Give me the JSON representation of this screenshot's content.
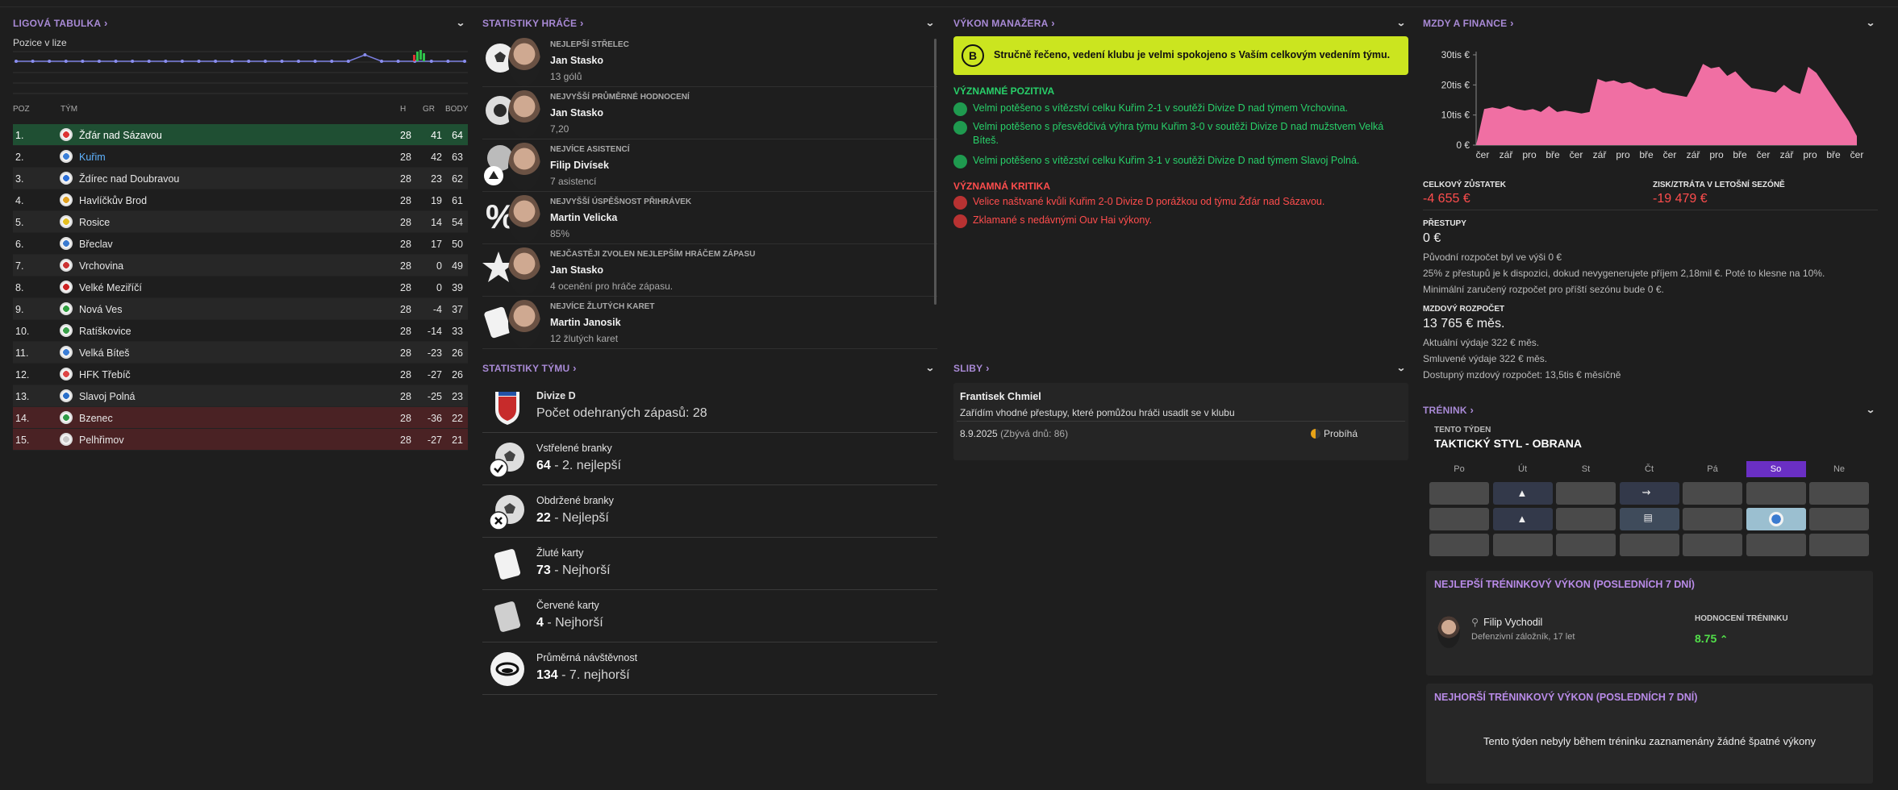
{
  "league": {
    "title": "LIGOVÁ TABULKA",
    "pos_label": "Pozice v lize",
    "cols": {
      "poz": "POZ",
      "tym": "TÝM",
      "h": "H",
      "gr": "GR",
      "body": "BODY"
    },
    "rows": [
      {
        "poz": "1.",
        "team": "Žďár nad Sázavou",
        "h": "28",
        "gr": "41",
        "body": "64",
        "style": "top",
        "crest": "#d33"
      },
      {
        "poz": "2.",
        "team": "Kuřim",
        "h": "28",
        "gr": "42",
        "body": "63",
        "style": "user",
        "crest": "#3a7fd8"
      },
      {
        "poz": "3.",
        "team": "Ždírec nad Doubravou",
        "h": "28",
        "gr": "23",
        "body": "62",
        "style": "",
        "crest": "#2b6fd8"
      },
      {
        "poz": "4.",
        "team": "Havlíčkův Brod",
        "h": "28",
        "gr": "19",
        "body": "61",
        "style": "",
        "crest": "#e0a020"
      },
      {
        "poz": "5.",
        "team": "Rosice",
        "h": "28",
        "gr": "14",
        "body": "54",
        "style": "",
        "crest": "#e6c021"
      },
      {
        "poz": "6.",
        "team": "Břeclav",
        "h": "28",
        "gr": "17",
        "body": "50",
        "style": "",
        "crest": "#3b7bd0"
      },
      {
        "poz": "7.",
        "team": "Vrchovina",
        "h": "28",
        "gr": "0",
        "body": "49",
        "style": "",
        "crest": "#c33"
      },
      {
        "poz": "8.",
        "team": "Velké Meziříčí",
        "h": "28",
        "gr": "0",
        "body": "39",
        "style": "",
        "crest": "#c22"
      },
      {
        "poz": "9.",
        "team": "Nová Ves",
        "h": "28",
        "gr": "-4",
        "body": "37",
        "style": "",
        "crest": "#2f9e3f"
      },
      {
        "poz": "10.",
        "team": "Ratíškovice",
        "h": "28",
        "gr": "-14",
        "body": "33",
        "style": "",
        "crest": "#3aa04a"
      },
      {
        "poz": "11.",
        "team": "Velká Bíteš",
        "h": "28",
        "gr": "-23",
        "body": "26",
        "style": "",
        "crest": "#3c7ed6"
      },
      {
        "poz": "12.",
        "team": "HFK Třebíč",
        "h": "28",
        "gr": "-27",
        "body": "26",
        "style": "",
        "crest": "#d44"
      },
      {
        "poz": "13.",
        "team": "Slavoj Polná",
        "h": "28",
        "gr": "-25",
        "body": "23",
        "style": "",
        "crest": "#2a6fc9"
      },
      {
        "poz": "14.",
        "team": "Bzenec",
        "h": "28",
        "gr": "-36",
        "body": "22",
        "style": "bot",
        "crest": "#2e9b47"
      },
      {
        "poz": "15.",
        "team": "Pelhřimov",
        "h": "28",
        "gr": "-27",
        "body": "21",
        "style": "bot",
        "crest": "#c8c8c8"
      }
    ],
    "position_history": [
      2,
      2,
      2,
      2,
      2,
      2,
      2,
      2,
      2,
      2,
      2,
      2,
      2,
      2,
      2,
      2,
      2,
      2,
      2,
      2,
      2,
      1,
      2,
      2,
      2,
      2,
      2,
      2
    ]
  },
  "player_stats": {
    "title": "STATISTIKY HRÁČE",
    "items": [
      {
        "label": "NEJLEPŠÍ STŘELEC",
        "name": "Jan Stasko",
        "value": "13 gólů",
        "icon": "soccer-ball"
      },
      {
        "label": "NEJVYŠŠÍ PRŮMĚRNÉ HODNOCENÍ",
        "name": "Jan Stasko",
        "value": "7,20",
        "icon": "gear"
      },
      {
        "label": "NEJVÍCE ASISTENCÍ",
        "name": "Filip Divísek",
        "value": "7 asistencí",
        "icon": "assist"
      },
      {
        "label": "NEJVYŠŠÍ ÚSPĚŠNOST PŘIHRÁVEK",
        "name": "Martin Velicka",
        "value": "85%",
        "icon": "percent"
      },
      {
        "label": "NEJČASTĚJI ZVOLEN NEJLEPŠÍM HRÁČEM ZÁPASU",
        "name": "Jan Stasko",
        "value": "4 ocenění pro hráče zápasu.",
        "icon": "star"
      },
      {
        "label": "NEJVÍCE ŽLUTÝCH KARET",
        "name": "Martin Janosik",
        "value": "12 žlutých karet",
        "icon": "card"
      }
    ]
  },
  "team_stats": {
    "title": "STATISTIKY TÝMU",
    "items": [
      {
        "label": "Divize D",
        "value_main": "",
        "value_rest": "Počet odehraných zápasů: 28",
        "icon": "federation-crest",
        "bold_label": true
      },
      {
        "label": "Vstřelené branky",
        "value_main": "64",
        "value_rest": " - 2. nejlepší",
        "icon": "ball-check"
      },
      {
        "label": "Obdržené branky",
        "value_main": "22",
        "value_rest": " - Nejlepší",
        "icon": "ball-x"
      },
      {
        "label": "Žluté karty",
        "value_main": "73",
        "value_rest": " - Nejhorší",
        "icon": "yellow-card"
      },
      {
        "label": "Červené karty",
        "value_main": "4",
        "value_rest": " - Nejhorší",
        "icon": "red-card"
      },
      {
        "label": "Průměrná návštěvnost",
        "value_main": "134",
        "value_rest": " - 7. nejhorší",
        "icon": "stadium"
      }
    ]
  },
  "manager": {
    "title": "VÝKON MANAŽERA",
    "grade": "B",
    "banner": "Stručně řečeno, vedení klubu je velmi spokojeno s Vaším celkovým vedením týmu.",
    "pos_title": "VÝZNAMNÉ POZITIVA",
    "positives": [
      "Velmi potěšeno s vítězství celku Kuřim 2-1 v soutěži Divize D nad týmem Vrchovina.",
      "Velmi potěšeno s přesvědčivá výhra týmu Kuřim 3-0 v soutěži Divize D nad mužstvem Velká Bíteš.",
      "Velmi potěšeno s vítězství celku Kuřim 3-1 v soutěži Divize D nad týmem Slavoj Polná."
    ],
    "neg_title": "VÝZNAMNÁ KRITIKA",
    "negatives": [
      "Velice naštvané kvůli Kuřim 2-0 Divize D porážkou od týmu Žďár nad Sázavou.",
      "Zklamané s nedávnými Ouv Hai výkony."
    ],
    "colors": {
      "positive": "#28d06a",
      "negative": "#ff4d4d",
      "banner": "#cbe51f"
    }
  },
  "promises": {
    "title": "SLIBY",
    "person": "Frantisek Chmiel",
    "text": "Zařídím vhodné přestupy, které pomůžou hráči usadit se v klubu",
    "date": "8.9.2025",
    "days": "(Zbývá dnů: 86)",
    "status": "Probíhá"
  },
  "finance": {
    "title": "MZDY A FINANCE",
    "chart_data": {
      "type": "area",
      "y_ticks": [
        "30tis €",
        "20tis €",
        "10tis €",
        "0 €"
      ],
      "ylim": [
        0,
        30000
      ],
      "x_labels": [
        "čer",
        "zář",
        "pro",
        "bře",
        "čer",
        "zář",
        "pro",
        "bře",
        "čer",
        "zář",
        "pro",
        "bře",
        "čer",
        "zář",
        "pro",
        "bře",
        "čer"
      ],
      "values": [
        0,
        12000,
        12500,
        12000,
        13000,
        12000,
        11500,
        12000,
        11000,
        13000,
        11000,
        11500,
        11000,
        10500,
        11000,
        22000,
        21000,
        21500,
        20500,
        21000,
        19500,
        18500,
        19000,
        17500,
        17000,
        16500,
        16000,
        21000,
        27000,
        25500,
        26000,
        23000,
        24500,
        21500,
        19000,
        18500,
        18000,
        17500,
        20000,
        18000,
        17000,
        26000,
        24000,
        20000,
        16000,
        12000,
        8000,
        3000
      ]
    },
    "balance_label": "CELKOVÝ ZŮSTATEK",
    "balance": "-4 655 €",
    "profit_label": "ZISK/ZTRÁTA V LETOŠNÍ SEZÓNĚ",
    "profit": "-19 479 €",
    "transfers_label": "PŘESTUPY",
    "transfers": "0 €",
    "transfers_lines": [
      "Původní rozpočet byl ve výši 0 €",
      "25% z přestupů je k dispozici, dokud nevygenerujete příjem 2,18mil €. Poté to klesne na 10%.",
      "Minimální zaručený rozpočet pro příští sezónu bude 0 €."
    ],
    "wage_label": "MZDOVÝ ROZPOČET",
    "wage": "13 765 € měs.",
    "wage_lines": [
      "Aktuální výdaje 322 € měs.",
      "Smluvené výdaje 322 € měs.",
      "Dostupný mzdový rozpočet: 13,5tis € měsíčně"
    ],
    "colors": {
      "area": "#f06fa3",
      "negative": "#ff4d4d"
    }
  },
  "training": {
    "title": "TRÉNINK",
    "week_label": "TENTO TÝDEN",
    "focus": "TAKTICKÝ STYL - OBRANA",
    "days": [
      "Po",
      "Út",
      "St",
      "Čt",
      "Pá",
      "So",
      "Ne"
    ],
    "best_title": "NEJLEPŠÍ TRÉNINKOVÝ VÝKON (POSLEDNÍCH 7 DNÍ)",
    "player": "Filip Vychodil",
    "player_desc": "Defenzivní záložník, 17 let",
    "rating_label": "HODNOCENÍ TRÉNINKU",
    "rating": "8.75",
    "worst_title": "NEJHORŠÍ TRÉNINKOVÝ VÝKON (POSLEDNÍCH 7 DNÍ)",
    "worst_text": "Tento týden nebyly během tréninku zaznamenány žádné špatné výkony",
    "colors": {
      "accent": "#6a2fc4",
      "rating": "#52e04a"
    }
  }
}
